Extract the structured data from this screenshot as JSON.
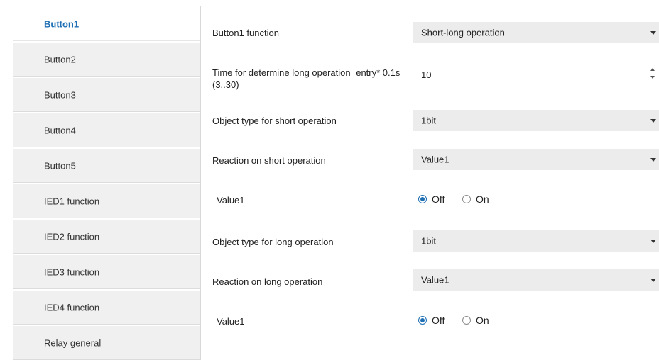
{
  "sidebar": {
    "items": [
      {
        "label": "Button1",
        "active": true
      },
      {
        "label": "Button2",
        "active": false
      },
      {
        "label": "Button3",
        "active": false
      },
      {
        "label": "Button4",
        "active": false
      },
      {
        "label": "Button5",
        "active": false
      },
      {
        "label": "IED1 function",
        "active": false
      },
      {
        "label": "IED2 function",
        "active": false
      },
      {
        "label": "IED3 function",
        "active": false
      },
      {
        "label": "IED4 function",
        "active": false
      },
      {
        "label": "Relay general",
        "active": false
      }
    ]
  },
  "form": {
    "button_function": {
      "label": "Button1 function",
      "value": "Short-long operation"
    },
    "long_time": {
      "label_line1": "Time for determine long operation=entry* 0.1s",
      "label_line2": "(3..30)",
      "value": "10"
    },
    "short_object_type": {
      "label": "Object type for short operation",
      "value": "1bit"
    },
    "short_reaction": {
      "label": "Reaction on short operation",
      "value": "Value1"
    },
    "short_value": {
      "label": "Value1",
      "options": [
        "Off",
        "On"
      ],
      "selected": "Off"
    },
    "long_object_type": {
      "label": "Object type for long operation",
      "value": "1bit"
    },
    "long_reaction": {
      "label": "Reaction on long operation",
      "value": "Value1"
    },
    "long_value": {
      "label": "Value1",
      "options": [
        "Off",
        "On"
      ],
      "selected": "Off"
    }
  },
  "colors": {
    "accent": "#1f6fb3",
    "select_bg": "#ececec",
    "sidebar_bg": "#f0f0f0"
  }
}
